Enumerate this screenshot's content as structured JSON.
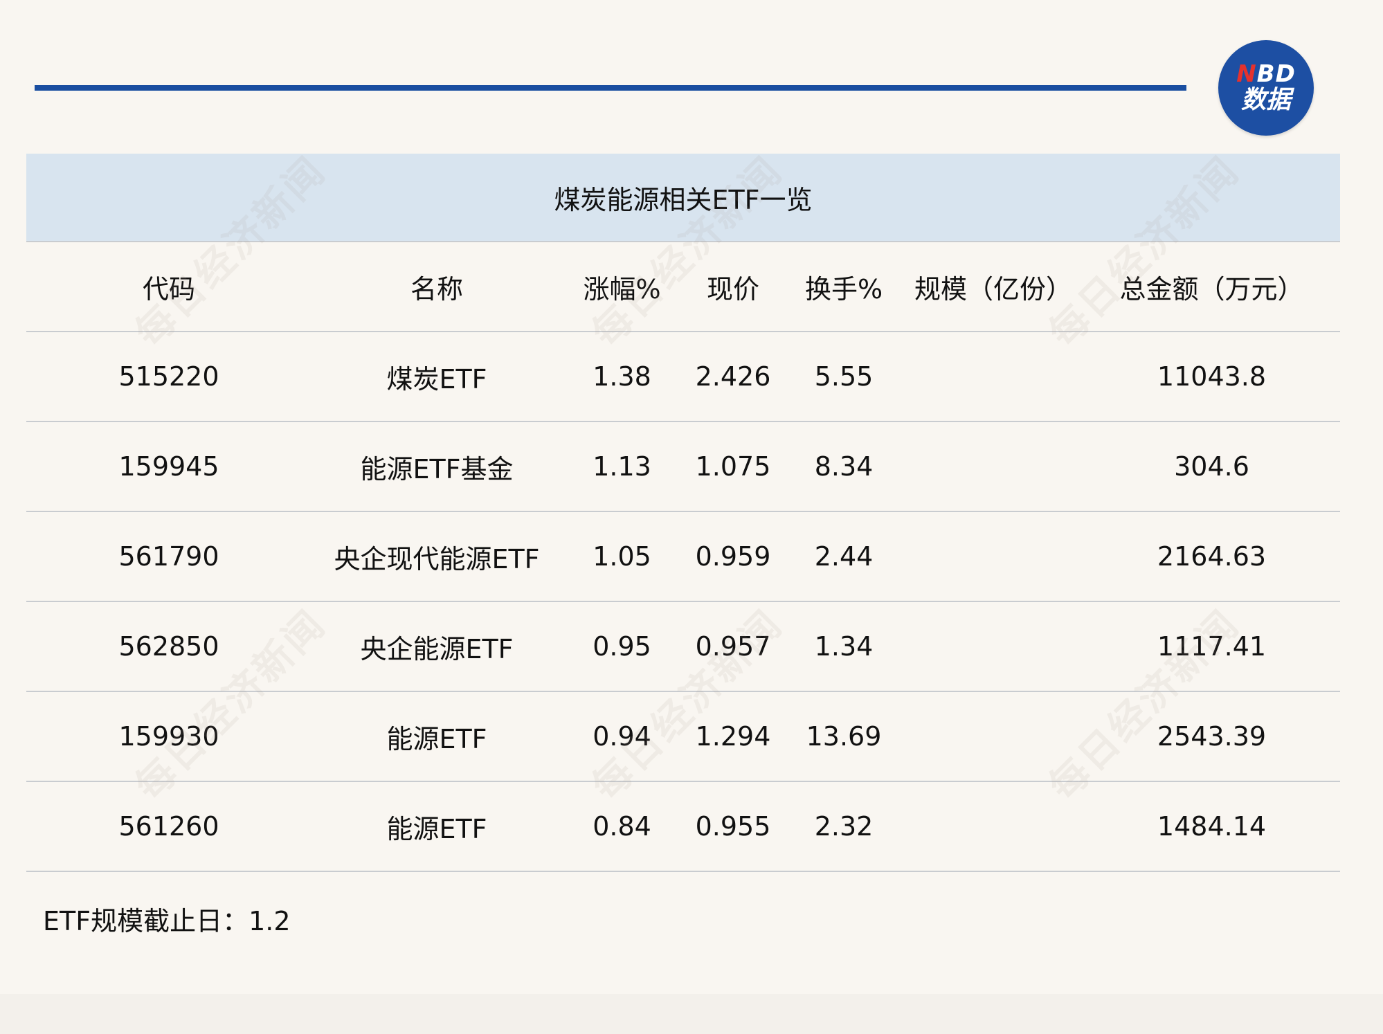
{
  "logo": {
    "brand_first": "N",
    "brand_rest": "BD",
    "sub": "数据",
    "accent_color": "#e5322d",
    "bg_color": "#1d4fa3"
  },
  "title": "煤炭能源相关ETF一览",
  "table": {
    "headers": [
      "代码",
      "名称",
      "涨幅%",
      "现价",
      "换手%",
      "规模（亿份）",
      "总金额（万元）"
    ],
    "rows": [
      [
        "515220",
        "煤炭ETF",
        "1.38",
        "2.426",
        "5.55",
        "",
        "11043.8"
      ],
      [
        "159945",
        "能源ETF基金",
        "1.13",
        "1.075",
        "8.34",
        "",
        "304.6"
      ],
      [
        "561790",
        "央企现代能源ETF",
        "1.05",
        "0.959",
        "2.44",
        "",
        "2164.63"
      ],
      [
        "562850",
        "央企能源ETF",
        "0.95",
        "0.957",
        "1.34",
        "",
        "1117.41"
      ],
      [
        "159930",
        "能源ETF",
        "0.94",
        "1.294",
        "13.69",
        "",
        "2543.39"
      ],
      [
        "561260",
        "能源ETF",
        "0.84",
        "0.955",
        "2.32",
        "",
        "1484.14"
      ]
    ]
  },
  "footnote": "ETF规模截止日：1.2",
  "watermark_text": "每日经济新闻",
  "colors": {
    "rule": "#1a4ea0",
    "title_band": "#d8e4ef",
    "background": "#f9f6f1"
  }
}
